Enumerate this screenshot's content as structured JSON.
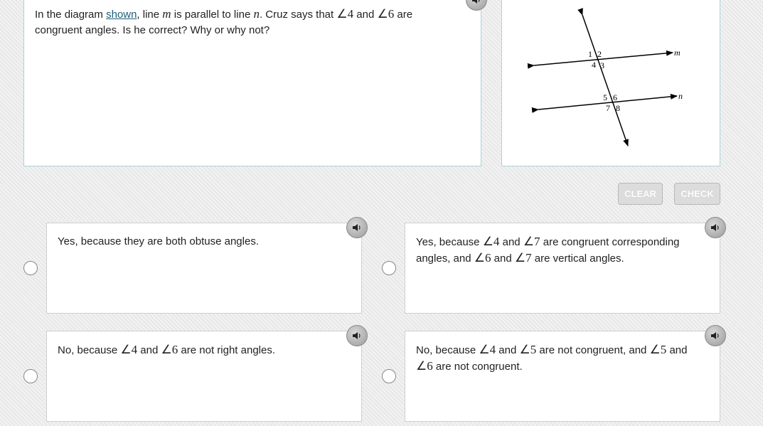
{
  "question": {
    "t1": "In the diagram ",
    "link": "shown",
    "t2": ", line ",
    "m": "m",
    "t3": " is parallel to line ",
    "n": "n",
    "t4": ". Cruz says that ",
    "a1": "∠4",
    "t5": " and ",
    "a2": "∠6",
    "t6": " are congruent angles. Is he correct? Why or why not?"
  },
  "diagram": {
    "line_m_label": "m",
    "line_n_label": "n",
    "angle_labels": [
      "1",
      "2",
      "4",
      "3",
      "5",
      "6",
      "7",
      "8"
    ]
  },
  "buttons": {
    "clear": "CLEAR",
    "check": "CHECK"
  },
  "choices": [
    {
      "parts": [
        "Yes, because they are both obtuse angles."
      ]
    },
    {
      "parts": [
        "Yes, because ",
        "∠4",
        " and ",
        "∠7",
        " are congruent corresponding angles, and ",
        "∠6",
        " and ",
        "∠7",
        " are vertical angles."
      ]
    },
    {
      "parts": [
        "No, because ",
        "∠4",
        " and ",
        "∠6",
        " are not right angles."
      ]
    },
    {
      "parts": [
        "No, because ",
        "∠4",
        " and ",
        "∠5",
        " are not congruent, and ",
        "∠5",
        " and ",
        "∠6",
        " are not congruent."
      ]
    }
  ]
}
